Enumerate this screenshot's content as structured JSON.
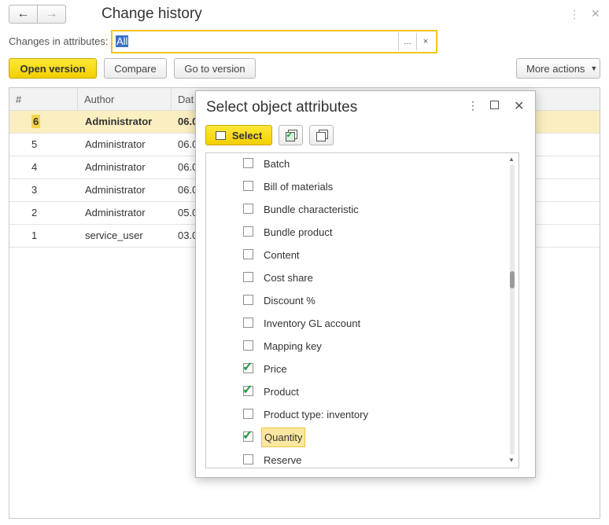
{
  "header": {
    "title": "Change history",
    "back_icon": "arrow-left-icon",
    "forward_icon": "arrow-right-icon"
  },
  "filter": {
    "label": "Changes in attributes:",
    "value": "All",
    "choose": "...",
    "clear": "×"
  },
  "toolbar": {
    "open_version": "Open version",
    "compare": "Compare",
    "go_to_version": "Go to version",
    "more_actions": "More actions"
  },
  "table": {
    "columns": [
      "#",
      "Author",
      "Dat"
    ],
    "rows": [
      {
        "num": "6",
        "author": "Administrator",
        "date": "06.0",
        "selected": true
      },
      {
        "num": "5",
        "author": "Administrator",
        "date": "06.0"
      },
      {
        "num": "4",
        "author": "Administrator",
        "date": "06.0"
      },
      {
        "num": "3",
        "author": "Administrator",
        "date": "06.0"
      },
      {
        "num": "2",
        "author": "Administrator",
        "date": "05.0"
      },
      {
        "num": "1",
        "author": "service_user",
        "date": "03.0"
      }
    ]
  },
  "dialog": {
    "title": "Select object attributes",
    "select_button": "Select",
    "attributes": [
      {
        "label": "Batch",
        "checked": false
      },
      {
        "label": "Bill of materials",
        "checked": false
      },
      {
        "label": "Bundle characteristic",
        "checked": false
      },
      {
        "label": "Bundle product",
        "checked": false
      },
      {
        "label": "Content",
        "checked": false
      },
      {
        "label": "Cost share",
        "checked": false
      },
      {
        "label": "Discount %",
        "checked": false
      },
      {
        "label": "Inventory GL account",
        "checked": false
      },
      {
        "label": "Mapping key",
        "checked": false
      },
      {
        "label": "Price",
        "checked": true
      },
      {
        "label": "Product",
        "checked": true
      },
      {
        "label": "Product type: inventory",
        "checked": false
      },
      {
        "label": "Quantity",
        "checked": true,
        "focused": true
      },
      {
        "label": "Reserve",
        "checked": false
      }
    ]
  },
  "colors": {
    "accent_yellow": "#f2cf00",
    "selection_row": "#fbeec0",
    "check_green": "#1a9a3a"
  }
}
